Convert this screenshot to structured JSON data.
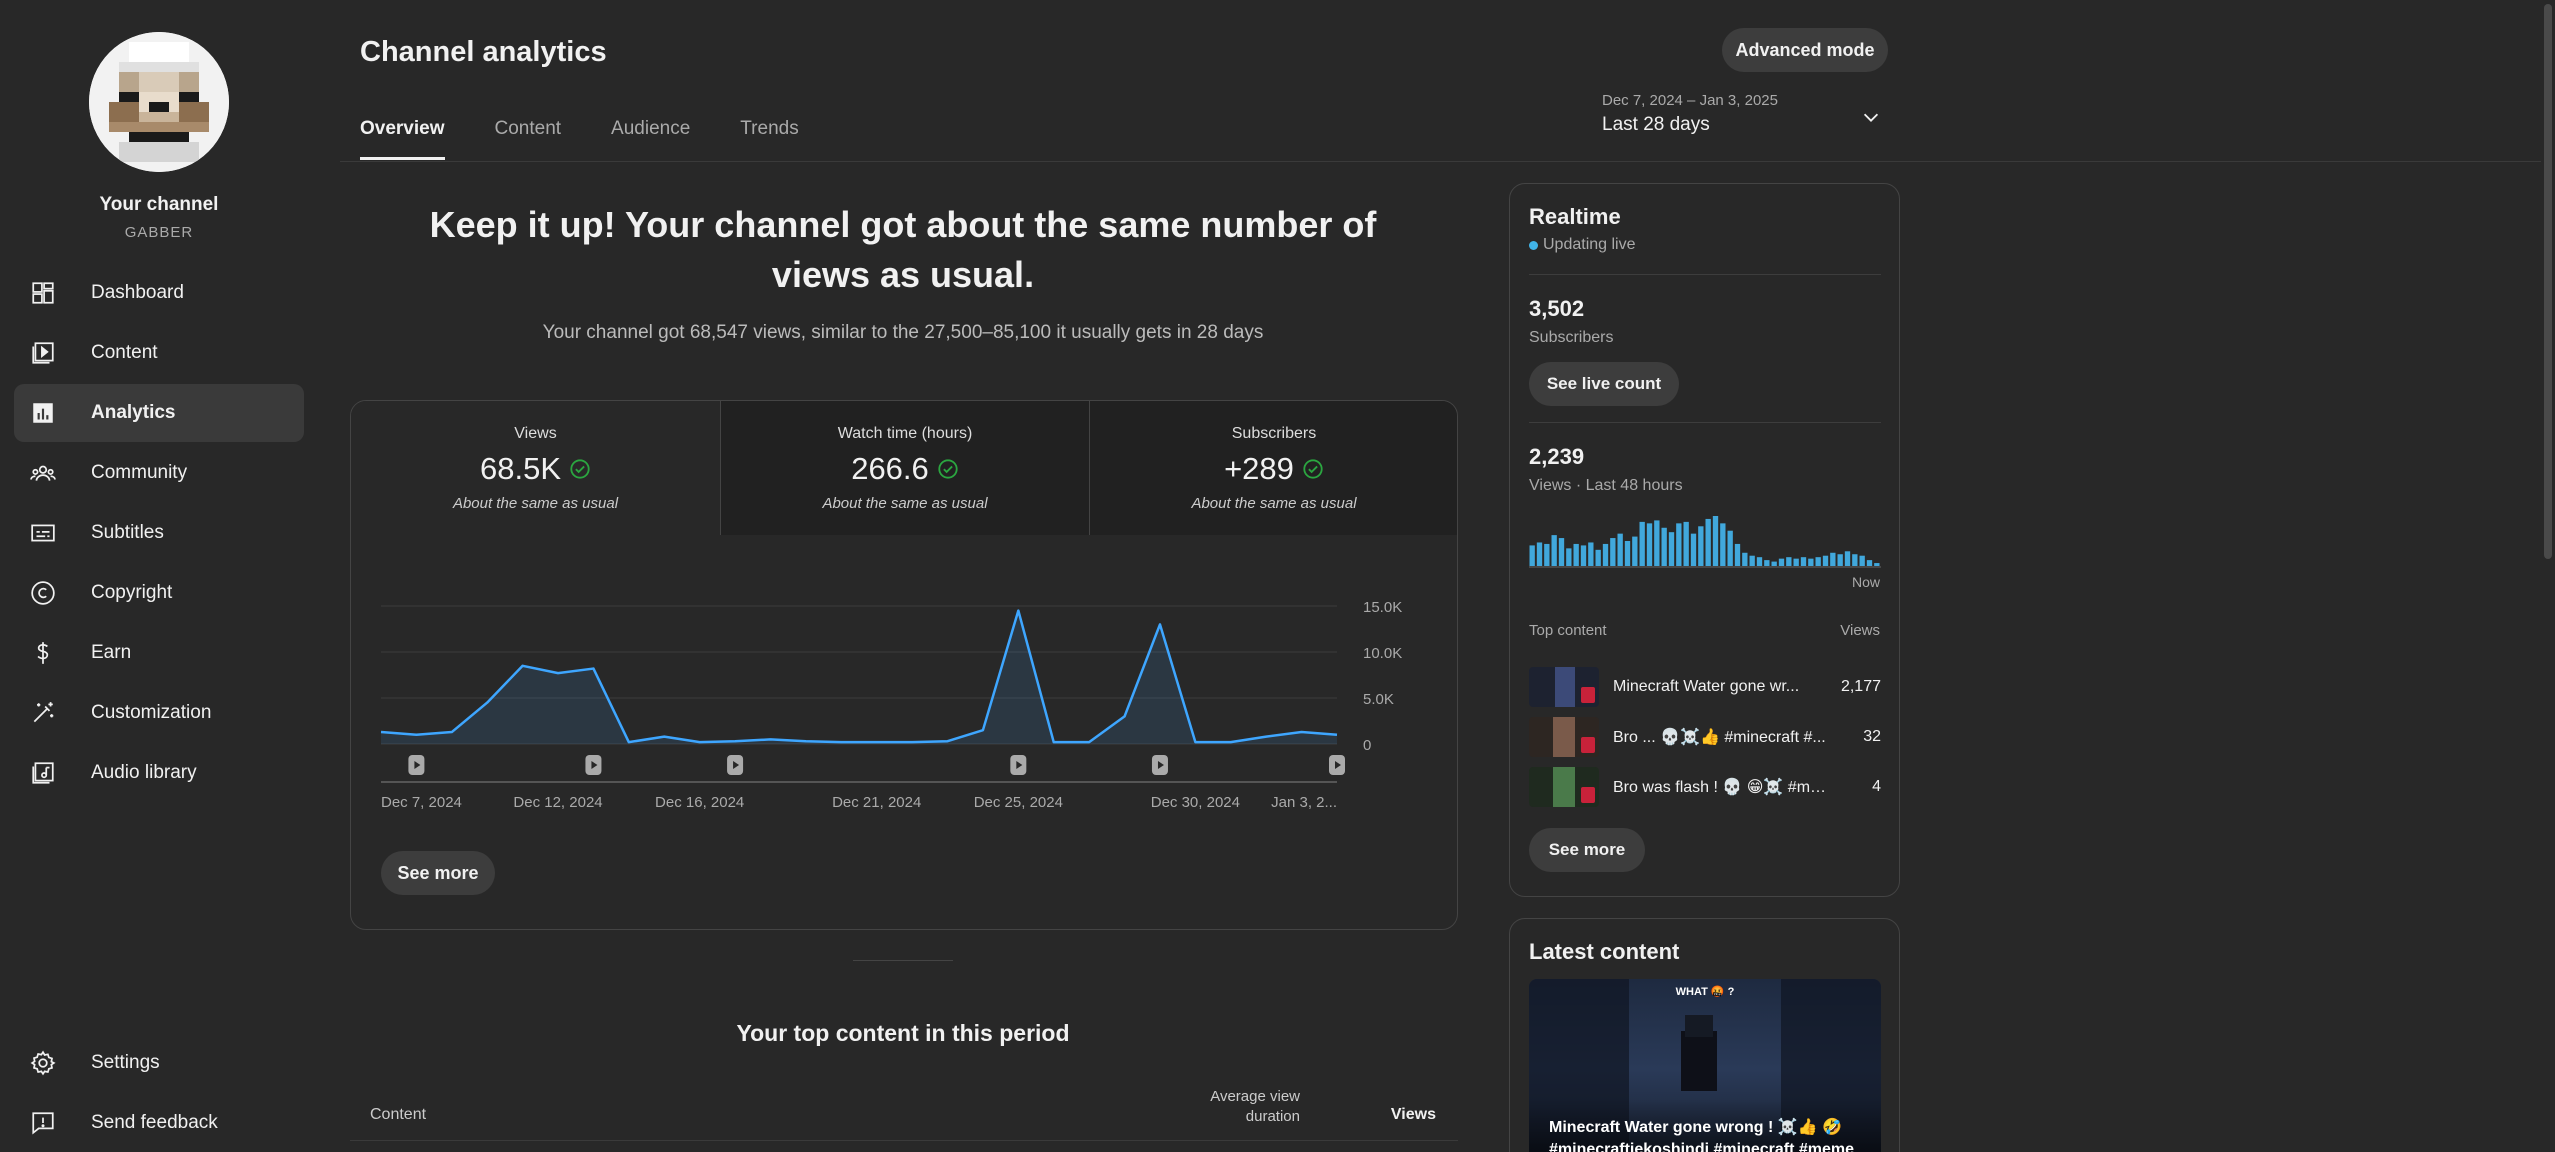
{
  "sidebar": {
    "channel_name": "Your channel",
    "channel_handle": "GABBER",
    "items": [
      {
        "label": "Dashboard",
        "icon": "dashboard-icon"
      },
      {
        "label": "Content",
        "icon": "content-icon"
      },
      {
        "label": "Analytics",
        "icon": "analytics-icon",
        "active": true
      },
      {
        "label": "Community",
        "icon": "community-icon"
      },
      {
        "label": "Subtitles",
        "icon": "subtitles-icon"
      },
      {
        "label": "Copyright",
        "icon": "copyright-icon"
      },
      {
        "label": "Earn",
        "icon": "dollar-icon"
      },
      {
        "label": "Customization",
        "icon": "magic-wand-icon"
      },
      {
        "label": "Audio library",
        "icon": "audio-library-icon"
      }
    ],
    "bottom_items": [
      {
        "label": "Settings",
        "icon": "gear-icon"
      },
      {
        "label": "Send feedback",
        "icon": "feedback-icon"
      }
    ]
  },
  "header": {
    "title": "Channel analytics",
    "advanced_mode": "Advanced mode",
    "tabs": [
      "Overview",
      "Content",
      "Audience",
      "Trends"
    ],
    "active_tab": "Overview",
    "date_range": "Dec 7, 2024 – Jan 3, 2025",
    "date_label": "Last 28 days"
  },
  "overview": {
    "headline": "Keep it up! Your channel got about the same number of views as usual.",
    "subline": "Your channel got 68,547 views, similar to the 27,500–85,100 it usually gets in 28 days",
    "metrics": [
      {
        "label": "Views",
        "value": "68.5K",
        "note": "About the same as usual"
      },
      {
        "label": "Watch time (hours)",
        "value": "266.6",
        "note": "About the same as usual"
      },
      {
        "label": "Subscribers",
        "value": "+289",
        "note": "About the same as usual"
      }
    ],
    "see_more": "See more"
  },
  "chart_data": {
    "type": "area",
    "series": [
      {
        "values": [
          1300,
          1000,
          1300,
          4500,
          8500,
          7700,
          8200,
          200,
          800,
          200,
          300,
          500,
          300,
          200,
          200,
          200,
          300,
          1500,
          14500,
          200,
          200,
          3000,
          13000,
          200,
          200,
          800,
          1300,
          1000
        ]
      }
    ],
    "x_tick_labels": [
      "Dec 7, 2024",
      "Dec 12, 2024",
      "Dec 16, 2024",
      "Dec 21, 2024",
      "Dec 25, 2024",
      "Dec 30, 2024",
      "Jan 3, 2..."
    ],
    "x_tick_indices": [
      0,
      5,
      9,
      14,
      18,
      23,
      27
    ],
    "y_ticks": [
      "0",
      "5.0K",
      "10.0K",
      "15.0K"
    ],
    "ylim": [
      0,
      15000
    ],
    "short_markers_at": [
      1,
      6,
      10,
      18,
      22,
      27
    ],
    "line_color": "#3ea6ff",
    "grid": true
  },
  "top_content": {
    "title": "Your top content in this period",
    "col_content": "Content",
    "col_avd": "Average view duration",
    "col_views": "Views"
  },
  "realtime": {
    "title": "Realtime",
    "status": "Updating live",
    "subscribers": "3,502",
    "subscribers_label": "Subscribers",
    "see_live_count": "See live count",
    "views": "2,239",
    "views_label": "Views · Last 48 hours",
    "now_label": "Now",
    "hourly_bars": [
      28,
      32,
      30,
      42,
      38,
      24,
      30,
      28,
      32,
      22,
      30,
      38,
      44,
      34,
      40,
      60,
      58,
      62,
      52,
      46,
      58,
      60,
      44,
      54,
      64,
      68,
      58,
      48,
      30,
      18,
      14,
      12,
      8,
      6,
      10,
      12,
      10,
      12,
      10,
      12,
      14,
      18,
      16,
      20,
      16,
      14,
      8,
      4
    ],
    "top_label": "Top content",
    "top_views_label": "Views",
    "top_items": [
      {
        "title": "Minecraft Water gone wr...",
        "views": "2,177"
      },
      {
        "title": "Bro ... 💀☠️👍 #minecraft #...",
        "views": "32"
      },
      {
        "title": "Bro was flash ! 💀 😁☠️ #min...",
        "views": "4"
      }
    ],
    "see_more": "See more"
  },
  "latest_content": {
    "title": "Latest content",
    "thumb_caption": "WHAT 🤬 ?",
    "video_title": "Minecraft Water gone wrong ! ☠️👍 🤣 #minecraftiekoshindi #minecraft #meme"
  },
  "colors": {
    "background": "#282828",
    "accent": "#3ea6ff",
    "check": "#2ba640"
  }
}
